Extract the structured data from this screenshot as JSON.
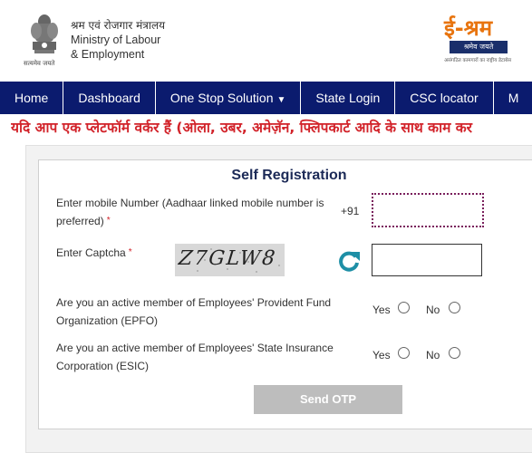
{
  "header": {
    "ministry_hindi": "श्रम एवं रोजगार मंत्रालय",
    "ministry_line1": "Ministry of Labour",
    "ministry_line2": "& Employment",
    "emblem_motto": "सत्यमेव जयते",
    "brand_title": "ई-श्रम",
    "brand_badge": "श्रमेव जयते",
    "brand_tagline": "असंगठित कामगारों का राष्ट्रीय डेटाबेस"
  },
  "nav": {
    "items": [
      "Home",
      "Dashboard",
      "One Stop Solution",
      "State Login",
      "CSC locator",
      "M"
    ],
    "dropdown_icon": "caret-down-icon"
  },
  "ticker": {
    "text": "यदि आप एक प्लेटफॉर्म वर्कर हैं (ओला, उबर, अमेज़ॅन, फ्लिपकार्ट आदि के साथ काम कर"
  },
  "form": {
    "title": "Self Registration",
    "mobile_label": "Enter mobile Number (Aadhaar linked mobile number is preferred)",
    "mobile_prefix": "+91",
    "mobile_value": "",
    "captcha_label": "Enter Captcha",
    "captcha_text": "Z7GLW8",
    "captcha_value": "",
    "required_marker": "*",
    "refresh_icon": "refresh-icon",
    "epfo_question": "Are you an active member of Employees' Provident Fund Organization (EPFO)",
    "esic_question": "Are you an active member of Employees' State Insurance Corporation (ESIC)",
    "yes_label": "Yes",
    "no_label": "No",
    "send_button": "Send OTP"
  },
  "colors": {
    "nav_bg": "#0b1b6e",
    "ticker_text": "#d2232a",
    "brand_orange": "#e8740e",
    "title_text": "#1c2a57",
    "refresh_icon": "#1e8fa6",
    "button_disabled": "#bdbdbd"
  }
}
